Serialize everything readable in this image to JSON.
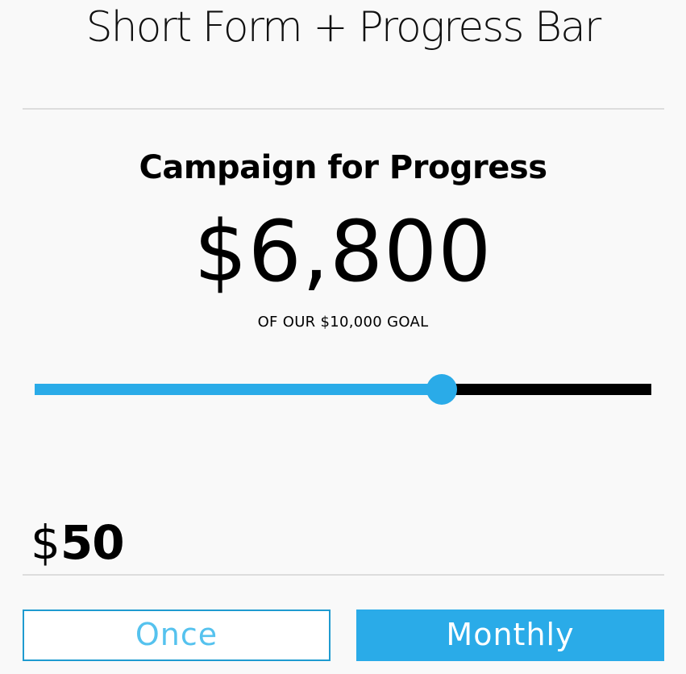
{
  "page": {
    "title": "Short Form + Progress Bar"
  },
  "campaign": {
    "title": "Campaign for Progress",
    "raised": "$6,800",
    "goal_text": "OF OUR $10,000 GOAL",
    "progress_fraction": 0.66
  },
  "colors": {
    "accent": "#2aabe8",
    "track": "#000000",
    "background": "#f9f9f9",
    "once_text": "#55c2ee"
  },
  "donation": {
    "currency_symbol": "$",
    "amount": "50"
  },
  "frequency": {
    "options": [
      {
        "label": "Once",
        "selected": false
      },
      {
        "label": "Monthly",
        "selected": true
      }
    ]
  }
}
